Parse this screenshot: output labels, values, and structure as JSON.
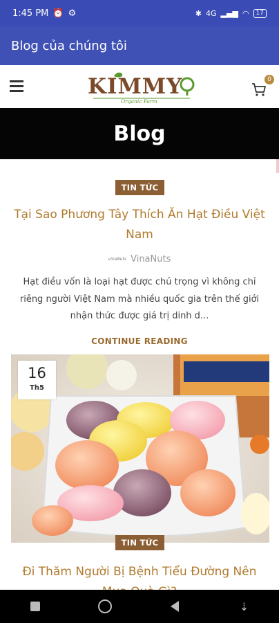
{
  "status_bar": {
    "time": "1:45 PM",
    "signal": "4G",
    "battery": "17"
  },
  "app_bar": {
    "title": "Blog của chúng tôi"
  },
  "site_header": {
    "logo_text": "KIMMY",
    "logo_tagline": "Organic Farm",
    "cart_count": "0"
  },
  "hero": {
    "title": "Blog"
  },
  "posts": [
    {
      "category": "TIN TỨC",
      "title": "Tại Sao Phương Tây Thích Ăn Hạt Điều Việt Nam",
      "author_logo": "vinaNuts",
      "author": "VinaNuts",
      "excerpt": "Hạt điều vốn là loại hạt được chú trọng vì không chỉ riêng người Việt Nam mà nhiều quốc gia trên thế giới nhận thức được giá trị dinh d...",
      "read_more": "CONTINUE READING"
    },
    {
      "date_day": "16",
      "date_month": "Th5",
      "category": "TIN TỨC",
      "title": "Đi Thăm Người Bị Bệnh Tiểu Đường Nên Mua Quà Gì?"
    }
  ],
  "colors": {
    "status_bar": "#3a4bb5",
    "app_bar": "#3f51b5",
    "hero": "#050505",
    "tag": "#8b5e34",
    "title": "#b07a2d",
    "logo_brown": "#7a4a2a",
    "logo_green": "#5a9a2e"
  },
  "icons": {
    "menu": "hamburger-icon",
    "cart": "cart-icon",
    "nav_recent": "square-icon",
    "nav_home": "circle-icon",
    "nav_back": "triangle-back-icon",
    "nav_extra": "arrow-down-icon"
  }
}
